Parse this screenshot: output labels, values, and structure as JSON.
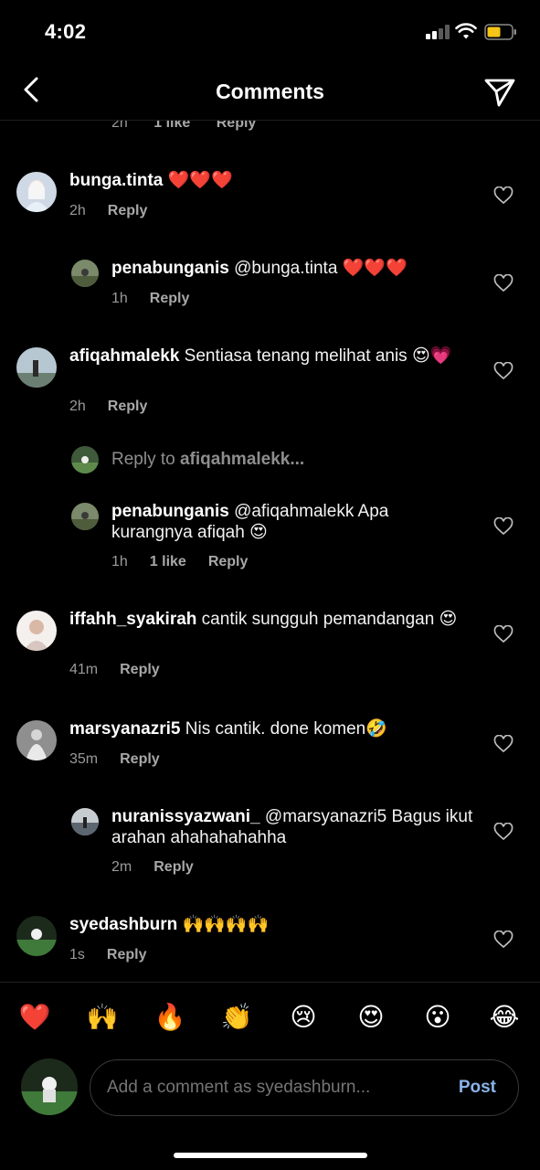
{
  "status": {
    "time": "4:02"
  },
  "header": {
    "title": "Comments"
  },
  "partial_meta": {
    "time": "2h",
    "likes": "1 like",
    "reply": "Reply"
  },
  "comments": [
    {
      "user": "bunga.tinta",
      "text": " ❤️❤️❤️",
      "time": "2h",
      "reply": "Reply"
    },
    {
      "user": "penabunganis",
      "text": " @bunga.tinta ❤️❤️❤️",
      "time": "1h",
      "reply": "Reply"
    },
    {
      "user": "afiqahmalekk",
      "text": " Sentiasa tenang melihat anis 😍💗",
      "time": "2h",
      "reply": "Reply"
    },
    {
      "user": "penabunganis",
      "text": " @afiqahmalekk Apa kurangnya afiqah 😍",
      "time": "1h",
      "likes": "1 like",
      "reply": "Reply"
    },
    {
      "user": "iffahh_syakirah",
      "text": " cantik sungguh pemandangan 😍",
      "time": "41m",
      "reply": "Reply"
    },
    {
      "user": "marsyanazri5",
      "text": " Nis cantik. done komen🤣",
      "time": "35m",
      "reply": "Reply"
    },
    {
      "user": "nuranissyazwani_",
      "text": " @marsyanazri5 Bagus ikut arahan ahahahahahha",
      "time": "2m",
      "reply": "Reply"
    },
    {
      "user": "syedashburn",
      "text": " 🙌🙌🙌🙌",
      "time": "1s",
      "reply": "Reply"
    }
  ],
  "reply_to": {
    "prefix": "Reply to ",
    "user": "afiqahmalekk..."
  },
  "emojis": [
    "❤️",
    "🙌",
    "🔥",
    "👏",
    "😢",
    "😍",
    "😮",
    "😂"
  ],
  "composer": {
    "placeholder": "Add a comment as syedashburn...",
    "post_label": "Post"
  },
  "colors": {
    "background": "#000000",
    "meta": "#9a9a9a",
    "post": "#8ab4e8"
  }
}
